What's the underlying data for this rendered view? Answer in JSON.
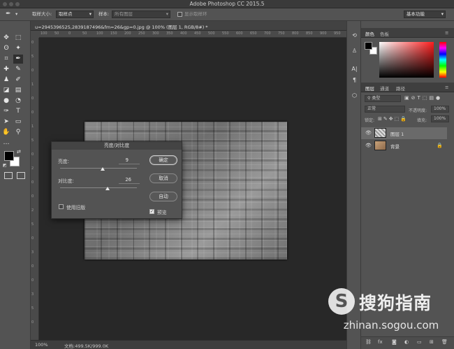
{
  "app": {
    "title": "Adobe Photoshop CC 2015.5"
  },
  "options_bar": {
    "sample_size_label": "取样大小:",
    "sample_size_value": "取样点",
    "sample_label": "样本:",
    "sample_value": "所有图层",
    "show_ring_label": "显示取样环",
    "workspace": "基本功能"
  },
  "document": {
    "tab": "u=2945396525,2839187496&fm=26&gp=0.jpg @ 100% (图层 1, RGB/8#) *",
    "zoom": "100%",
    "doc_info": "文档:499.5K/999.0K",
    "ruler_h": [
      "100",
      "50",
      "0",
      "50",
      "100",
      "150",
      "200",
      "250",
      "300",
      "350",
      "400",
      "450",
      "500",
      "550",
      "600",
      "650",
      "700",
      "750",
      "800",
      "850",
      "900",
      "950",
      "100"
    ],
    "ruler_v": [
      "0",
      "5",
      "0",
      "1",
      "0",
      "0",
      "1",
      "5",
      "0",
      "2",
      "0",
      "0",
      "2",
      "5",
      "0",
      "3",
      "0",
      "0",
      "3",
      "5",
      "0"
    ]
  },
  "dialog": {
    "title": "亮度/对比度",
    "brightness_label": "亮度:",
    "brightness_value": "9",
    "brightness_pct": 0.55,
    "contrast_label": "对比度:",
    "contrast_value": "26",
    "contrast_pct": 0.62,
    "legacy_label": "使用旧版",
    "ok_label": "确定",
    "cancel_label": "取消",
    "auto_label": "自动",
    "preview_label": "预览",
    "preview_checked": true,
    "legacy_checked": false
  },
  "color_panel": {
    "tab_color": "颜色",
    "tab_swatches": "色板",
    "fg_color": "#000000",
    "bg_color": "#ffffff"
  },
  "layers_panel": {
    "tabs": [
      "图层",
      "通道",
      "路径"
    ],
    "filter_kind": "类型",
    "blend_mode": "正常",
    "opacity_label": "不透明度:",
    "opacity_value": "100%",
    "lock_label": "锁定:",
    "fill_label": "填充:",
    "fill_value": "100%",
    "layers": [
      {
        "name": "图层 1",
        "selected": true
      },
      {
        "name": "背景",
        "selected": false,
        "locked": true
      }
    ]
  },
  "watermark": {
    "brand": "搜狗指南",
    "url": "zhinan.sogou.com"
  }
}
